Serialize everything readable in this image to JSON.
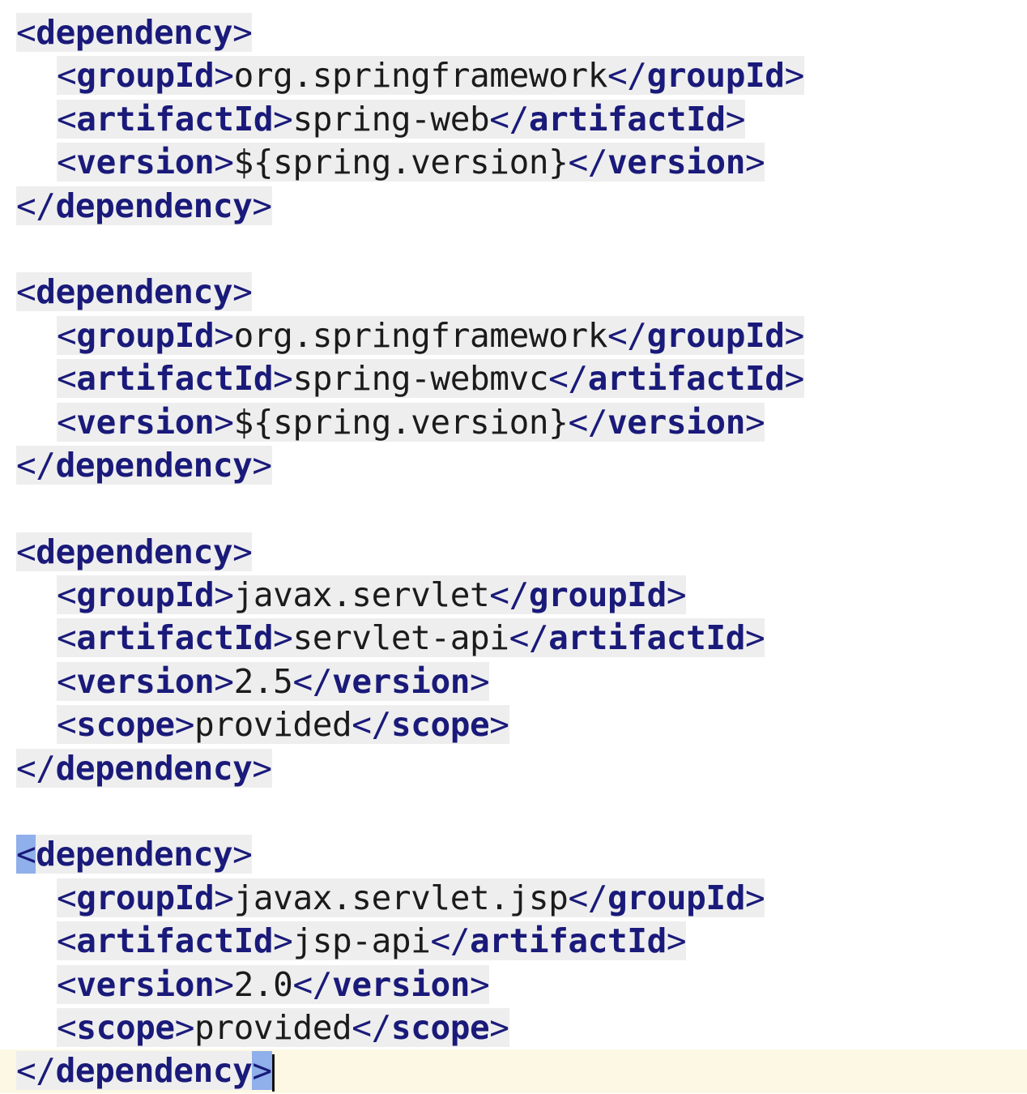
{
  "editor": {
    "lines": [
      {
        "indent": 0,
        "open": "dependency",
        "text": "",
        "close": ""
      },
      {
        "indent": 1,
        "open": "groupId",
        "text": "org.springframework",
        "close": "groupId"
      },
      {
        "indent": 1,
        "open": "artifactId",
        "text": "spring-web",
        "close": "artifactId"
      },
      {
        "indent": 1,
        "open": "version",
        "text": "${spring.version}",
        "close": "version"
      },
      {
        "indent": 0,
        "open": "",
        "text": "",
        "close": "dependency"
      },
      {
        "blank": true
      },
      {
        "indent": 0,
        "open": "dependency",
        "text": "",
        "close": ""
      },
      {
        "indent": 1,
        "open": "groupId",
        "text": "org.springframework",
        "close": "groupId"
      },
      {
        "indent": 1,
        "open": "artifactId",
        "text": "spring-webmvc",
        "close": "artifactId"
      },
      {
        "indent": 1,
        "open": "version",
        "text": "${spring.version}",
        "close": "version"
      },
      {
        "indent": 0,
        "open": "",
        "text": "",
        "close": "dependency"
      },
      {
        "blank": true
      },
      {
        "indent": 0,
        "open": "dependency",
        "text": "",
        "close": ""
      },
      {
        "indent": 1,
        "open": "groupId",
        "text": "javax.servlet",
        "close": "groupId"
      },
      {
        "indent": 1,
        "open": "artifactId",
        "text": "servlet-api",
        "close": "artifactId"
      },
      {
        "indent": 1,
        "open": "version",
        "text": "2.5",
        "close": "version"
      },
      {
        "indent": 1,
        "open": "scope",
        "text": "provided",
        "close": "scope"
      },
      {
        "indent": 0,
        "open": "",
        "text": "",
        "close": "dependency"
      },
      {
        "blank": true
      },
      {
        "indent": 0,
        "open": "dependency",
        "text": "",
        "close": "",
        "match": true
      },
      {
        "indent": 1,
        "open": "groupId",
        "text": "javax.servlet.jsp",
        "close": "groupId"
      },
      {
        "indent": 1,
        "open": "artifactId",
        "text": "jsp-api",
        "close": "artifactId"
      },
      {
        "indent": 1,
        "open": "version",
        "text": "2.0",
        "close": "version"
      },
      {
        "indent": 1,
        "open": "scope",
        "text": "provided",
        "close": "scope"
      },
      {
        "indent": 0,
        "open": "",
        "text": "",
        "close": "dependency",
        "current": true,
        "match": true
      }
    ]
  },
  "colors": {
    "tag": "#1a1a7a",
    "text": "#1b1b1b",
    "chunk_highlight": "#eeeeee",
    "current_line": "#fdf8e3",
    "bracket_match": "#8fb0ea"
  }
}
